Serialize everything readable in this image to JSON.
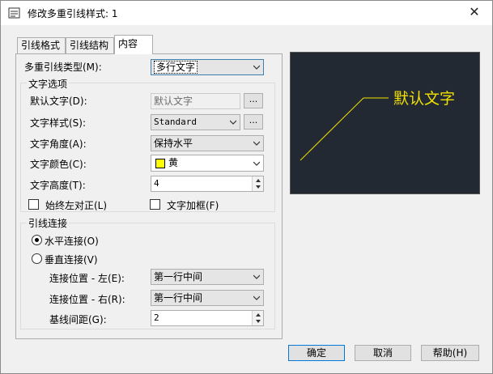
{
  "window": {
    "title": "修改多重引线样式: 1",
    "close_glyph": "✕"
  },
  "tabs": [
    {
      "label": "引线格式"
    },
    {
      "label": "引线结构"
    },
    {
      "label": "内容"
    }
  ],
  "content": {
    "leader_type_label": "多重引线类型(M):",
    "leader_type_value": "多行文字",
    "text_group_title": "文字选项",
    "default_text_label": "默认文字(D):",
    "default_text_value": "默认文字",
    "text_style_label": "文字样式(S):",
    "text_style_value": "Standard",
    "text_angle_label": "文字角度(A):",
    "text_angle_value": "保持水平",
    "text_color_label": "文字颜色(C):",
    "text_color_value": "黄",
    "text_height_label": "文字高度(T):",
    "text_height_value": "4",
    "always_left_label": "始终左对正(L)",
    "text_frame_label": "文字加框(F)",
    "browse_label": "...",
    "connection_group_title": "引线连接",
    "horizontal_label": "水平连接(O)",
    "vertical_label": "垂直连接(V)",
    "attach_left_label": "连接位置 - 左(E):",
    "attach_left_value": "第一行中间",
    "attach_right_label": "连接位置 - 右(R):",
    "attach_right_value": "第一行中间",
    "landing_gap_label": "基线间距(G):",
    "landing_gap_value": "2"
  },
  "preview": {
    "text": "默认文字",
    "color": "#f0e000",
    "background": "#232932"
  },
  "buttons": {
    "ok": "确定",
    "cancel": "取消",
    "help": "帮助(H)"
  }
}
